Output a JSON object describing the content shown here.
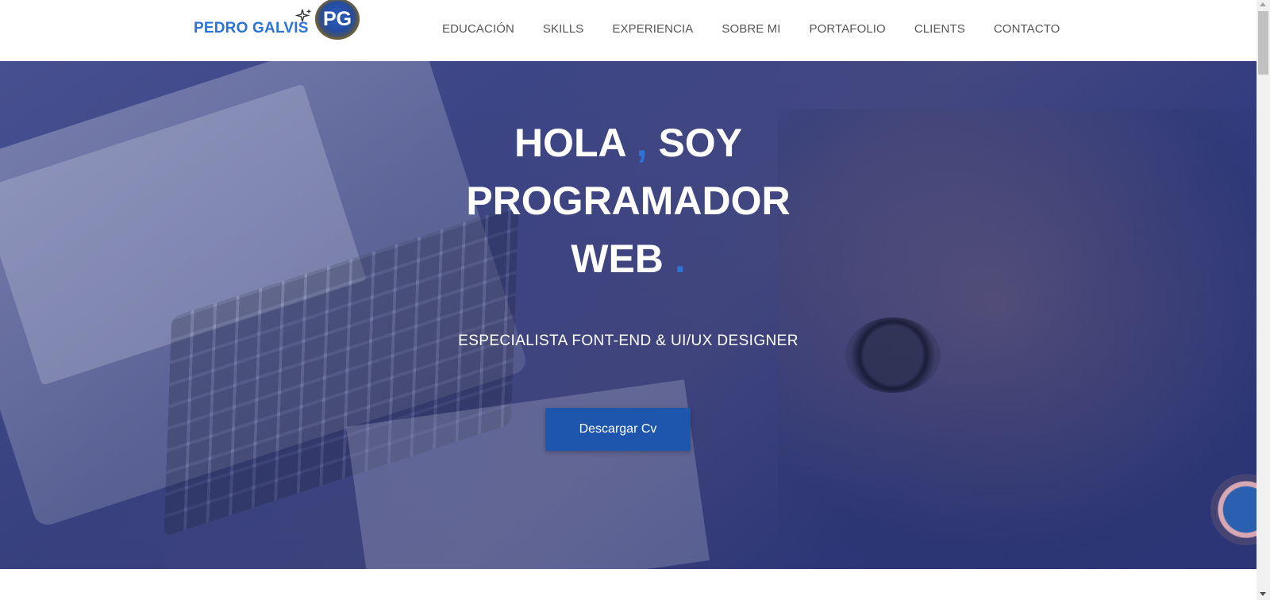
{
  "navbar": {
    "brand_name": "PEDRO GALVIS",
    "brand_icon": "sparkle-icon",
    "logo_initials": "PG",
    "links": [
      "EDUCACIÓN",
      "SKILLS",
      "EXPERIENCIA",
      "SOBRE MI",
      "PORTAFOLIO",
      "CLIENTS",
      "CONTACTO"
    ]
  },
  "hero": {
    "title_part1": "HOLA",
    "title_comma": ",",
    "title_part2": "SOY",
    "title_line2": "PROGRAMADOR",
    "title_line3": "WEB",
    "title_dot": ".",
    "subtitle": "ESPECIALISTA FONT-END & UI/UX DESIGNER",
    "cta_label": "Descargar Cv"
  },
  "colors": {
    "accent": "#2b73d6",
    "button": "#1e56ad",
    "hero_overlay": "#343e8c"
  }
}
